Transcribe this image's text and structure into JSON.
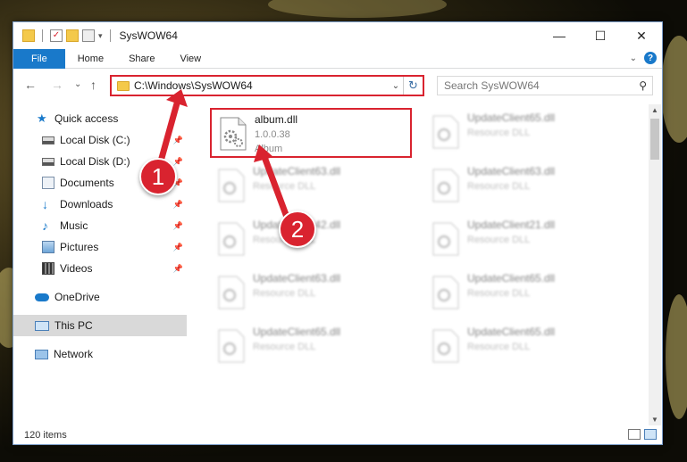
{
  "window": {
    "title": "SysWOW64",
    "controls": {
      "minimize": "—",
      "maximize": "☐",
      "close": "✕"
    }
  },
  "ribbon": {
    "tabs": [
      "File",
      "Home",
      "Share",
      "View"
    ]
  },
  "navigation": {
    "back": "←",
    "forward": "→",
    "recent": "⌄",
    "up": "↑",
    "address": "C:\\Windows\\SysWOW64",
    "search_placeholder": "Search SysWOW64"
  },
  "sidebar": {
    "items": [
      {
        "label": "Quick access",
        "icon": "star-icon",
        "pinned": false
      },
      {
        "label": "Local Disk (C:)",
        "icon": "drive-icon",
        "pinned": true
      },
      {
        "label": "Local Disk (D:)",
        "icon": "drive-icon",
        "pinned": true
      },
      {
        "label": "Documents",
        "icon": "documents-icon",
        "pinned": true
      },
      {
        "label": "Downloads",
        "icon": "download-icon",
        "pinned": true
      },
      {
        "label": "Music",
        "icon": "music-icon",
        "pinned": true
      },
      {
        "label": "Pictures",
        "icon": "pictures-icon",
        "pinned": true
      },
      {
        "label": "Videos",
        "icon": "videos-icon",
        "pinned": true
      },
      {
        "label": "OneDrive",
        "icon": "cloud-icon",
        "pinned": false
      },
      {
        "label": "This PC",
        "icon": "pc-icon",
        "pinned": false,
        "selected": true
      },
      {
        "label": "Network",
        "icon": "network-icon",
        "pinned": false
      }
    ]
  },
  "files": [
    {
      "name": "album.dll",
      "line2": "1.0.0.38",
      "line3": "Album",
      "selected": true
    },
    {
      "name": "UpdateClient65.dll",
      "line2": "Resource DLL",
      "line3": ""
    },
    {
      "name": "UpdateClient63.dll",
      "line2": "Resource DLL",
      "line3": ""
    },
    {
      "name": "UpdateClient63.dll",
      "line2": "Resource DLL",
      "line3": ""
    },
    {
      "name": "UpdateClient42.dll",
      "line2": "Resource DLL",
      "line3": ""
    },
    {
      "name": "UpdateClient21.dll",
      "line2": "Resource DLL",
      "line3": ""
    },
    {
      "name": "UpdateClient63.dll",
      "line2": "Resource DLL",
      "line3": ""
    },
    {
      "name": "UpdateClient65.dll",
      "line2": "Resource DLL",
      "line3": ""
    },
    {
      "name": "UpdateClient65.dll",
      "line2": "Resource DLL",
      "line3": ""
    },
    {
      "name": "UpdateClient65.dll",
      "line2": "Resource DLL",
      "line3": ""
    }
  ],
  "status": {
    "count": "120 items"
  },
  "annotations": {
    "step1": "1",
    "step2": "2",
    "color": "#d9232f"
  }
}
